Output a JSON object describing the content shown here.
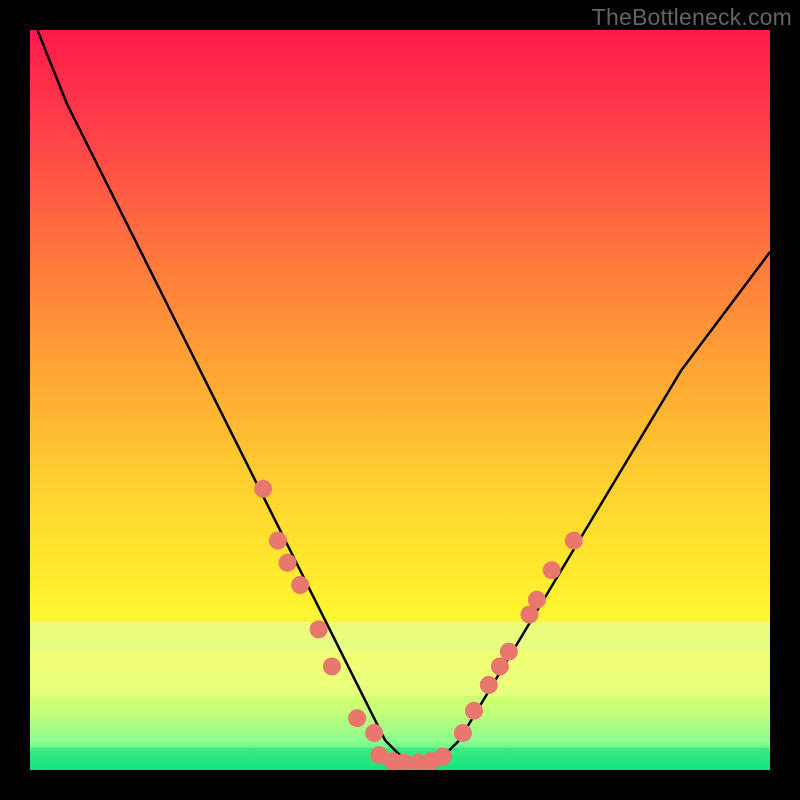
{
  "watermark": "TheBottleneck.com",
  "chart_data": {
    "type": "line",
    "title": "",
    "xlabel": "",
    "ylabel": "",
    "xlim": [
      0,
      100
    ],
    "ylim": [
      0,
      100
    ],
    "series": [
      {
        "name": "curve",
        "x": [
          1,
          3,
          5,
          8,
          11,
          14,
          17,
          20,
          23,
          26,
          29,
          32,
          35,
          38,
          41,
          44,
          46,
          48,
          50,
          52,
          54,
          56,
          58,
          61,
          64,
          67,
          70,
          73,
          76,
          79,
          82,
          85,
          88,
          91,
          94,
          97,
          100
        ],
        "y": [
          100,
          95,
          90,
          84,
          78,
          72,
          66,
          60,
          54,
          48,
          42,
          36,
          30,
          24,
          18,
          12,
          8,
          4,
          2,
          1,
          1,
          2,
          4,
          9,
          14,
          19,
          24,
          29,
          34,
          39,
          44,
          49,
          54,
          58,
          62,
          66,
          70
        ]
      }
    ],
    "points": {
      "name": "scatter_markers",
      "color_hex": "#e8786e",
      "radius": 9,
      "data": [
        {
          "x": 31.5,
          "y": 38
        },
        {
          "x": 33.5,
          "y": 31
        },
        {
          "x": 34.8,
          "y": 28
        },
        {
          "x": 36.5,
          "y": 25
        },
        {
          "x": 39.0,
          "y": 19
        },
        {
          "x": 40.8,
          "y": 14
        },
        {
          "x": 44.2,
          "y": 7
        },
        {
          "x": 46.5,
          "y": 5
        },
        {
          "x": 47.2,
          "y": 2
        },
        {
          "x": 49.0,
          "y": 1.2
        },
        {
          "x": 50.5,
          "y": 1
        },
        {
          "x": 52.5,
          "y": 1
        },
        {
          "x": 54.2,
          "y": 1.2
        },
        {
          "x": 55.8,
          "y": 1.8
        },
        {
          "x": 58.5,
          "y": 5
        },
        {
          "x": 60.0,
          "y": 8
        },
        {
          "x": 62.0,
          "y": 11.5
        },
        {
          "x": 63.5,
          "y": 14
        },
        {
          "x": 64.7,
          "y": 16
        },
        {
          "x": 67.5,
          "y": 21
        },
        {
          "x": 68.5,
          "y": 23
        },
        {
          "x": 70.5,
          "y": 27
        },
        {
          "x": 73.5,
          "y": 31
        }
      ]
    },
    "bands": [
      {
        "name": "cyan-band",
        "y0": 16,
        "y1": 20,
        "color": "#e0ffab"
      },
      {
        "name": "yellow-band",
        "y0": 10,
        "y1": 16,
        "color": "#f6ff8c"
      },
      {
        "name": "green-band",
        "y0": 0,
        "y1": 3,
        "color": "#13e07e"
      }
    ]
  }
}
